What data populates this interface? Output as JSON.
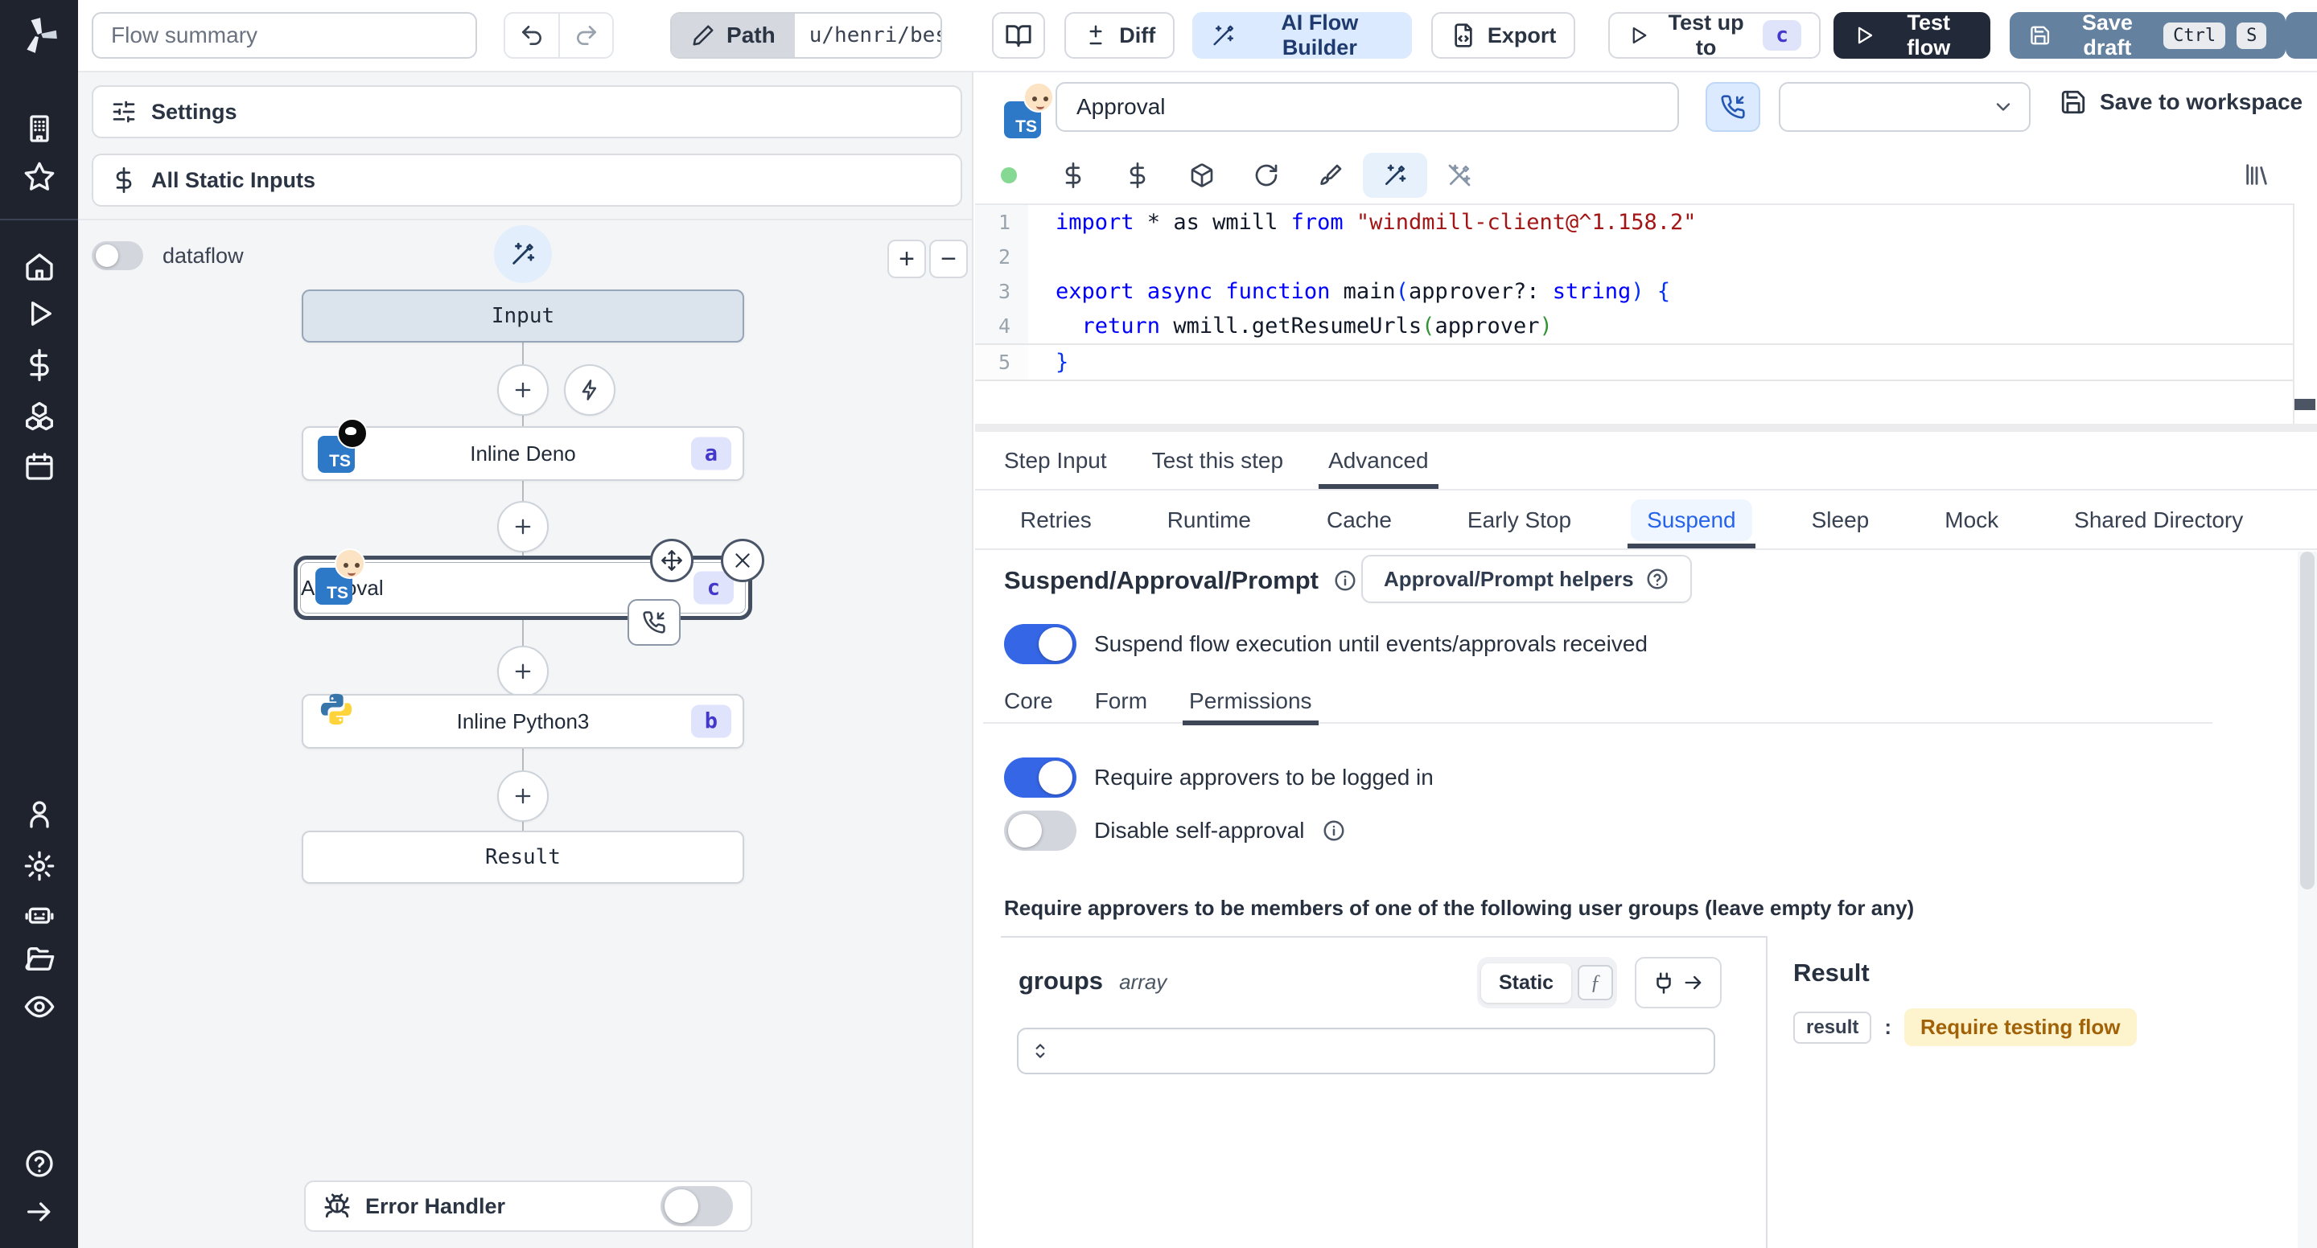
{
  "toolbar": {
    "flow_summary_placeholder": "Flow summary",
    "path_label": "Path",
    "path_value": "u/henri/bes",
    "diff_label": "Diff",
    "ai_flow_builder_label": "AI Flow Builder",
    "export_label": "Export",
    "test_up_to_label": "Test up to",
    "test_up_to_badge": "c",
    "test_flow_label": "Test flow",
    "save_draft_label": "Save draft",
    "save_draft_keys": {
      "mod": "Ctrl",
      "key": "S"
    }
  },
  "sidebar": {
    "icons": [
      "windmill-logo",
      "building",
      "star",
      "home",
      "runs-play",
      "variables-dollar",
      "resources-cubes",
      "schedules-calendar",
      "users-user",
      "settings-gear",
      "workers-robot",
      "folders-folder",
      "audit-eye",
      "help-question",
      "expand-arrow-right"
    ]
  },
  "flow_panel": {
    "settings_label": "Settings",
    "static_inputs_label": "All Static Inputs",
    "dataflow_label": "dataflow",
    "zoom_in_label": "+",
    "zoom_out_label": "−",
    "dataflow_enabled": false,
    "nodes": {
      "input": {
        "label": "Input"
      },
      "deno": {
        "label": "Inline Deno",
        "badge": "a"
      },
      "approval": {
        "label": "Approval",
        "badge": "c"
      },
      "python": {
        "label": "Inline Python3",
        "badge": "b"
      },
      "result": {
        "label": "Result"
      }
    },
    "error_handler_label": "Error Handler",
    "error_handler_enabled": false
  },
  "step_header": {
    "name_value": "Approval",
    "save_to_workspace_label": "Save to workspace"
  },
  "editor": {
    "language_status_color": "#86d993",
    "lines": [
      {
        "num": "1",
        "tokens": [
          {
            "c": "kw",
            "t": "import"
          },
          {
            "c": "pl",
            "t": " * as wmill "
          },
          {
            "c": "kw",
            "t": "from"
          },
          {
            "c": "pl",
            "t": " "
          },
          {
            "c": "str",
            "t": "\"windmill-client@^1.158.2\""
          }
        ]
      },
      {
        "num": "2",
        "tokens": []
      },
      {
        "num": "3",
        "tokens": [
          {
            "c": "kw",
            "t": "export"
          },
          {
            "c": "pl",
            "t": " "
          },
          {
            "c": "kw",
            "t": "async"
          },
          {
            "c": "pl",
            "t": " "
          },
          {
            "c": "kw",
            "t": "function"
          },
          {
            "c": "pl",
            "t": " main"
          },
          {
            "c": "b1",
            "t": "("
          },
          {
            "c": "pl",
            "t": "approver?: "
          },
          {
            "c": "kw",
            "t": "string"
          },
          {
            "c": "b1",
            "t": ")"
          },
          {
            "c": "pl",
            "t": " "
          },
          {
            "c": "b1",
            "t": "{"
          }
        ]
      },
      {
        "num": "4",
        "tokens": [
          {
            "c": "pl",
            "t": "  "
          },
          {
            "c": "kw",
            "t": "return"
          },
          {
            "c": "pl",
            "t": " wmill.getResumeUrls"
          },
          {
            "c": "b2",
            "t": "("
          },
          {
            "c": "pl",
            "t": "approver"
          },
          {
            "c": "b2",
            "t": ")"
          }
        ]
      },
      {
        "num": "5",
        "current": true,
        "tokens": [
          {
            "c": "b1",
            "t": "}"
          }
        ]
      }
    ]
  },
  "tabs": {
    "main": [
      "Step Input",
      "Test this step",
      "Advanced"
    ],
    "active_main": "Advanced",
    "sub": [
      "Retries",
      "Runtime",
      "Cache",
      "Early Stop",
      "Suspend",
      "Sleep",
      "Mock",
      "Shared Directory"
    ],
    "active_sub": "Suspend"
  },
  "suspend": {
    "title": "Suspend/Approval/Prompt",
    "helpers_button_label": "Approval/Prompt helpers",
    "suspend_toggle_label": "Suspend flow execution until events/approvals received",
    "suspend_enabled": true,
    "sub_tabs": [
      "Core",
      "Form",
      "Permissions"
    ],
    "active_sub_tab": "Permissions",
    "require_login_label": "Require approvers to be logged in",
    "require_login_enabled": true,
    "disable_self_approval_label": "Disable self-approval",
    "disable_self_approval_enabled": false,
    "groups_heading": "Require approvers to be members of one of the following user groups (leave empty for any)"
  },
  "groups_panel": {
    "name": "groups",
    "type": "array",
    "static_label": "Static",
    "fx_label": "ƒ"
  },
  "result_panel": {
    "title": "Result",
    "key": "result",
    "colon": ":",
    "value": "Require testing flow"
  },
  "colors": {
    "toggle_on": "#3566e6",
    "accent_blue": "#2563eb",
    "ai_builder_bg": "#dbeafe",
    "dark_button": "#222938",
    "save_draft_button": "#64819f",
    "node_badge_bg": "#dfe3fc",
    "node_badge_text": "#4338ca",
    "result_value_bg": "#fdf3cd",
    "result_value_text": "#a16207",
    "sidebar_bg": "#1e232e"
  }
}
